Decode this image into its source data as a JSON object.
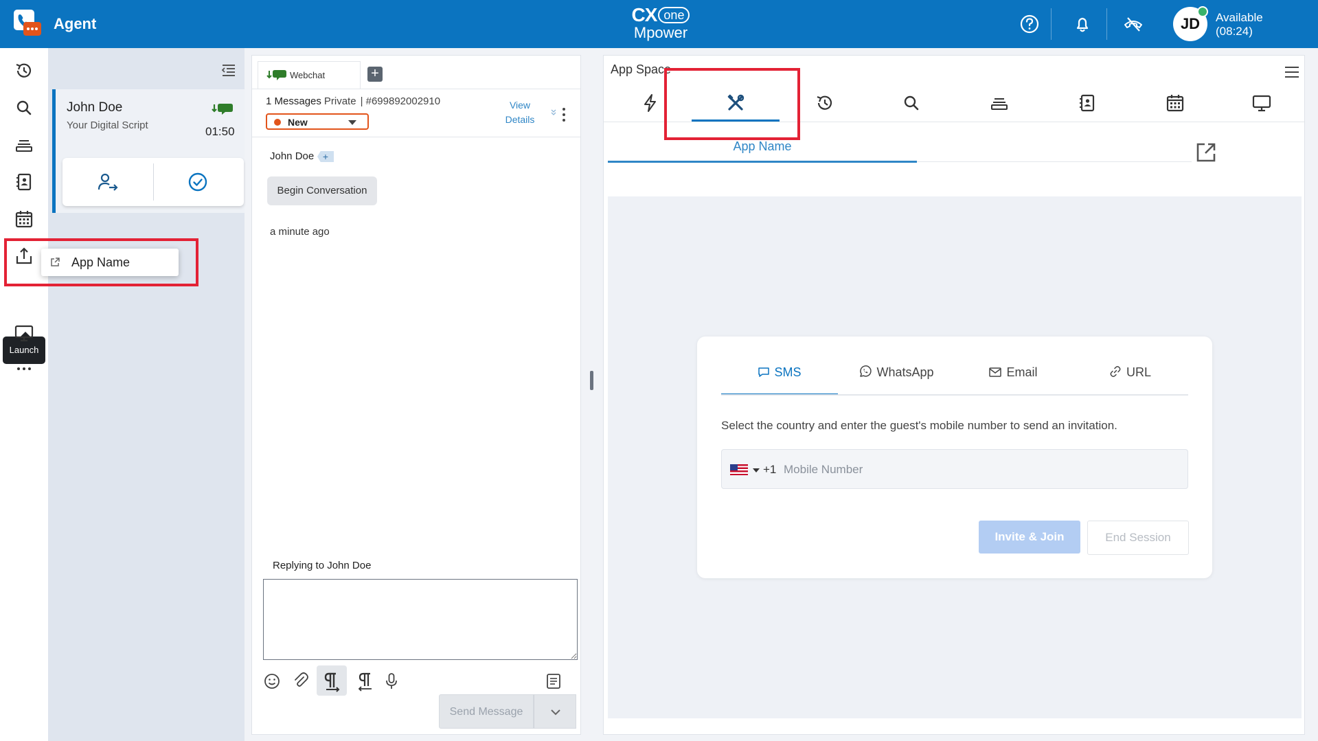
{
  "header": {
    "app_title": "Agent",
    "brand_cx": "CX",
    "brand_one": "one",
    "brand_mpower": "Mpower",
    "avatar_initials": "JD",
    "status_label": "Available",
    "status_timer": "(08:24)",
    "color": "#0b74c0"
  },
  "rail": {
    "items": [
      "history-icon",
      "search-icon",
      "queue-icon",
      "directory-icon",
      "calendar-icon",
      "launch-icon",
      "screen-icon",
      "more-icon"
    ],
    "tooltip": "Launch"
  },
  "launch_menu": {
    "item_label": "App Name"
  },
  "contact_card": {
    "name": "John Doe",
    "script": "Your Digital Script",
    "timer": "01:50"
  },
  "conversation": {
    "tab_label": "Webchat",
    "message_count": "1 Messages",
    "visibility": "Private",
    "case_id": "| #699892002910",
    "status_value": "New",
    "status_color": "#e2541b",
    "view_details": "View Details",
    "sender": "John Doe",
    "bubble_text": "Begin Conversation",
    "time_ago": "a minute ago",
    "reply_label": "Replying to John Doe",
    "send_label": "Send Message"
  },
  "app_space": {
    "title": "App Space",
    "tabs": [
      "bolt-icon",
      "tools-icon",
      "history-icon",
      "search-icon",
      "queue-icon",
      "directory-icon",
      "calendar-icon",
      "screen-icon"
    ],
    "selected_tab": "tools-icon",
    "subtab_label": "App Name"
  },
  "invite": {
    "tabs": [
      {
        "label": "SMS",
        "icon": "chat-icon",
        "selected": true
      },
      {
        "label": "WhatsApp",
        "icon": "whatsapp-icon",
        "selected": false
      },
      {
        "label": "Email",
        "icon": "mail-icon",
        "selected": false
      },
      {
        "label": "URL",
        "icon": "link-icon",
        "selected": false
      }
    ],
    "description": "Select the country and enter the guest's mobile number to send an invitation.",
    "dial_code": "+1",
    "phone_placeholder": "Mobile Number",
    "invite_button": "Invite & Join",
    "end_button": "End Session"
  },
  "highlight_color": "#e32235"
}
